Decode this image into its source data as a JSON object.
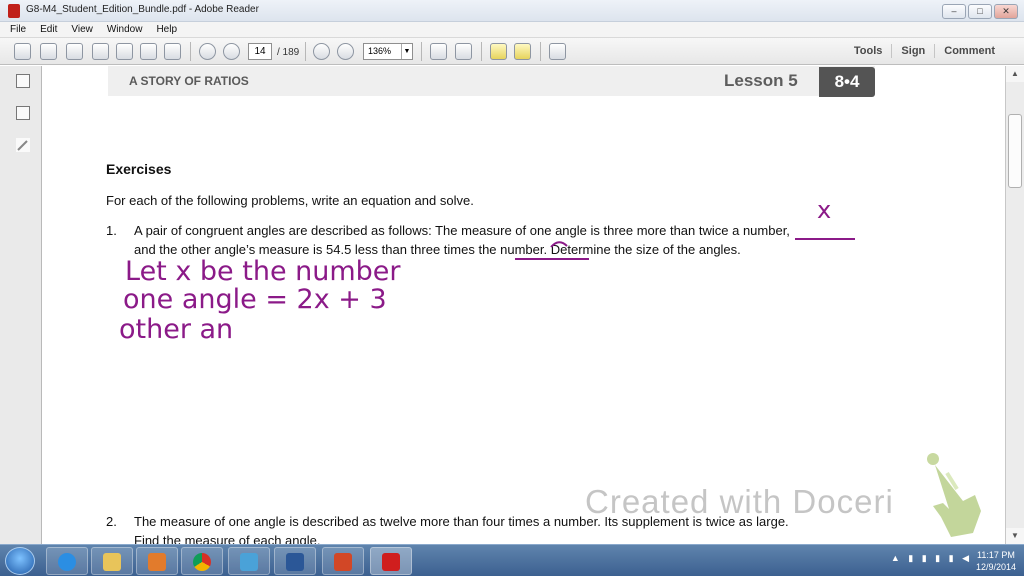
{
  "window": {
    "title": "G8-M4_Student_Edition_Bundle.pdf - Adobe Reader",
    "min_label": "–",
    "max_label": "□",
    "close_label": "✕"
  },
  "menu": [
    "File",
    "Edit",
    "View",
    "Window",
    "Help"
  ],
  "toolbar": {
    "page_current": "14",
    "page_total": "/ 189",
    "zoom": "136%",
    "right_tools": [
      "Tools",
      "Sign",
      "Comment"
    ]
  },
  "page": {
    "header_story": "A STORY OF RATIOS",
    "header_lesson": "Lesson 5",
    "header_badge": "8•4",
    "exercises_title": "Exercises",
    "intro": "For each of the following problems, write an equation and solve.",
    "problem1_num": "1.",
    "problem1_line1": "A pair of congruent angles are described as follows:  The measure of one angle is three more than twice a number,",
    "problem1_line2": "and the other angle’s measure is 54.5 less than three times the number.  Determine the size of the angles.",
    "problem2_num": "2.",
    "problem2_line1": "The measure of one angle is described as twelve more than four times a number.  Its supplement is twice as large.",
    "problem2_line2": "Find the measure of each angle."
  },
  "handwriting": {
    "x_mark": "x",
    "line1": "Let x be the number",
    "line2": "one angle = 2x + 3",
    "line3": "other an"
  },
  "watermark": "Created with Doceri",
  "taskbar": {
    "time": "11:17 PM",
    "date": "12/9/2014"
  },
  "colors": {
    "ink": "#8b1a88",
    "badge": "#545454"
  }
}
